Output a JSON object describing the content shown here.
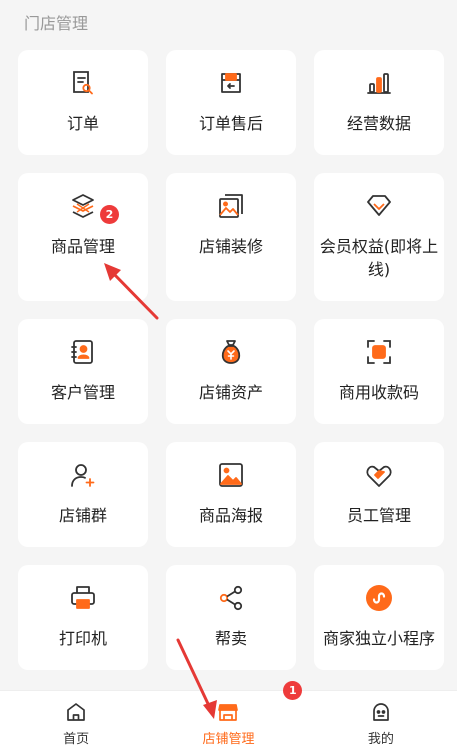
{
  "section": {
    "title": "门店管理"
  },
  "grid": {
    "items": [
      {
        "label": "订单",
        "icon": "order-icon"
      },
      {
        "label": "订单售后",
        "icon": "after-sales-icon"
      },
      {
        "label": "经营数据",
        "icon": "bar-chart-icon"
      },
      {
        "label": "商品管理",
        "icon": "layers-icon",
        "badge": "2"
      },
      {
        "label": "店铺装修",
        "icon": "decoration-icon"
      },
      {
        "label": "会员权益(即将上线)",
        "icon": "diamond-icon"
      },
      {
        "label": "客户管理",
        "icon": "contact-book-icon"
      },
      {
        "label": "店铺资产",
        "icon": "money-bag-icon"
      },
      {
        "label": "商用收款码",
        "icon": "scan-frame-icon"
      },
      {
        "label": "店铺群",
        "icon": "add-user-icon"
      },
      {
        "label": "商品海报",
        "icon": "image-icon"
      },
      {
        "label": "员工管理",
        "icon": "handshake-icon"
      },
      {
        "label": "打印机",
        "icon": "printer-icon"
      },
      {
        "label": "帮卖",
        "icon": "share-icon"
      },
      {
        "label": "商家独立小程序",
        "icon": "mini-program-icon"
      }
    ]
  },
  "tabbar": {
    "tabs": [
      {
        "label": "首页",
        "icon": "home-icon"
      },
      {
        "label": "店铺管理",
        "icon": "store-icon",
        "badge": "1",
        "active": true
      },
      {
        "label": "我的",
        "icon": "profile-icon"
      }
    ]
  },
  "colors": {
    "accent": "#ff6a1a",
    "badge": "#ee3b3b",
    "arrow": "#e53935"
  }
}
